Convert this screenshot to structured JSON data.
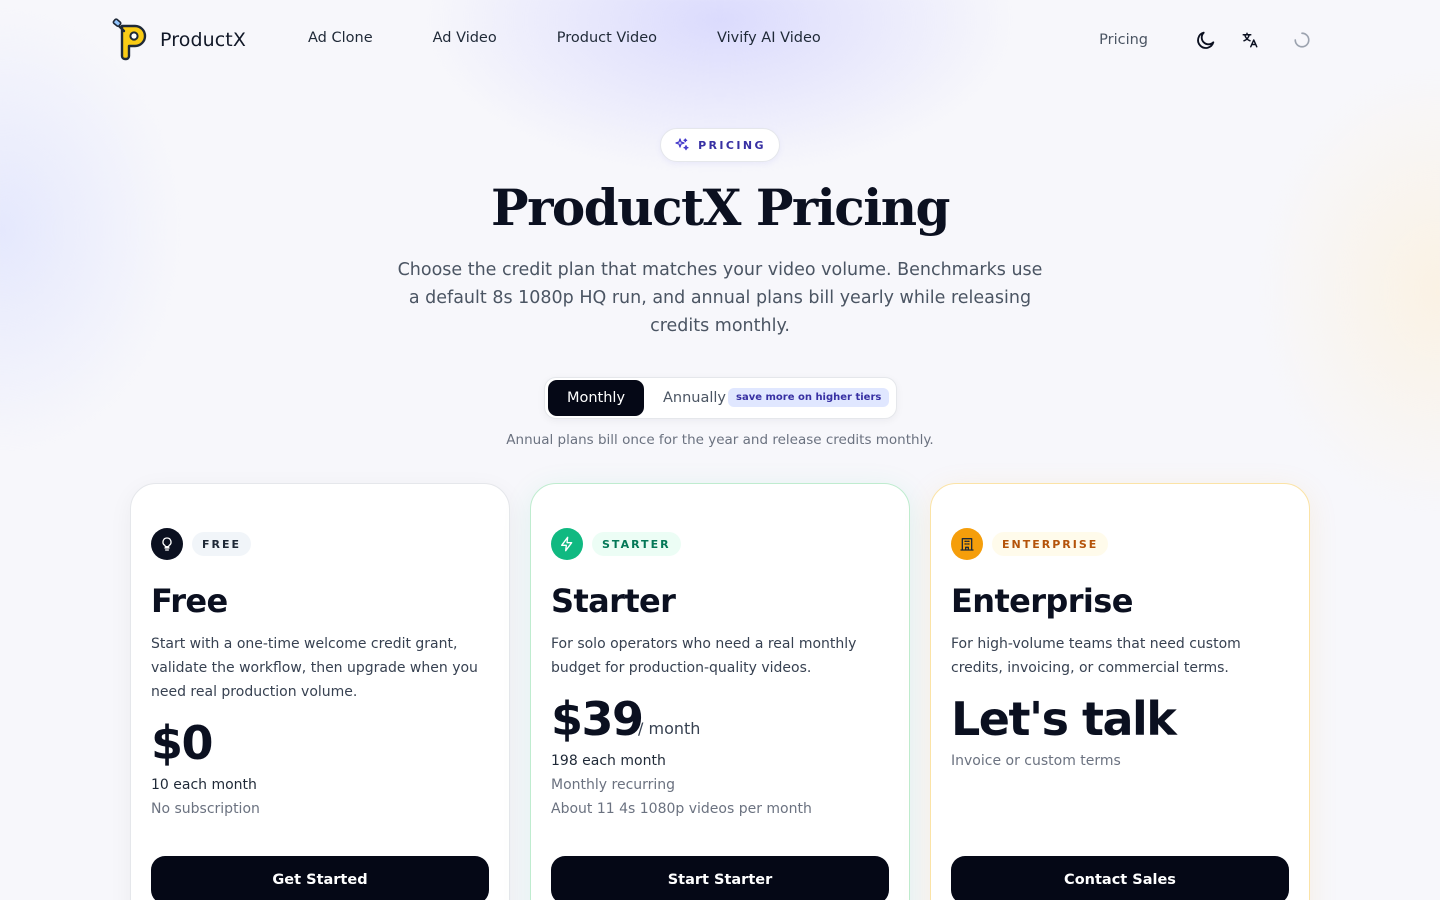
{
  "brand": {
    "name": "ProductX"
  },
  "nav": {
    "links": [
      "Ad Clone",
      "Ad Video",
      "Product Video",
      "Vivify AI Video"
    ],
    "pricing": "Pricing",
    "icons": [
      "moon-icon",
      "translate-icon",
      "loading-spinner-icon"
    ]
  },
  "hero": {
    "badge": "PRICING",
    "title": "ProductX Pricing",
    "subtitle": "Choose the credit plan that matches your video volume. Benchmarks use a default 8s 1080p HQ run, and annual plans bill yearly while releasing credits monthly."
  },
  "billing": {
    "monthly": "Monthly",
    "annually": "Annually",
    "save_badge": "save more on higher tiers",
    "selected": "Monthly",
    "note": "Annual plans bill once for the year and release credits monthly."
  },
  "plans": {
    "free": {
      "badge": "FREE",
      "name": "Free",
      "description": "Start with a one-time welcome credit grant, validate the workflow, then upgrade when you need real production volume.",
      "price": "$0",
      "credits": "10 each month",
      "detail": "No subscription",
      "cta": "Get Started",
      "icon": "lightbulb-icon",
      "accent": "#0b1020"
    },
    "starter": {
      "badge": "STARTER",
      "name": "Starter",
      "description": "For solo operators who need a real monthly budget for production-quality videos.",
      "price": "$39",
      "unit": "/ month",
      "credits": "198 each month",
      "detail": "Monthly recurring",
      "benchmark": "About 11 4s 1080p videos per month",
      "cta": "Start Starter",
      "icon": "lightning-icon",
      "accent": "#10b981"
    },
    "enterprise": {
      "badge": "ENTERPRISE",
      "name": "Enterprise",
      "description": "For high-volume teams that need custom credits, invoicing, or commercial terms.",
      "price": "Let's talk",
      "detail": "Invoice or custom terms",
      "cta": "Contact Sales",
      "icon": "building-icon",
      "accent": "#f59e0b"
    }
  }
}
